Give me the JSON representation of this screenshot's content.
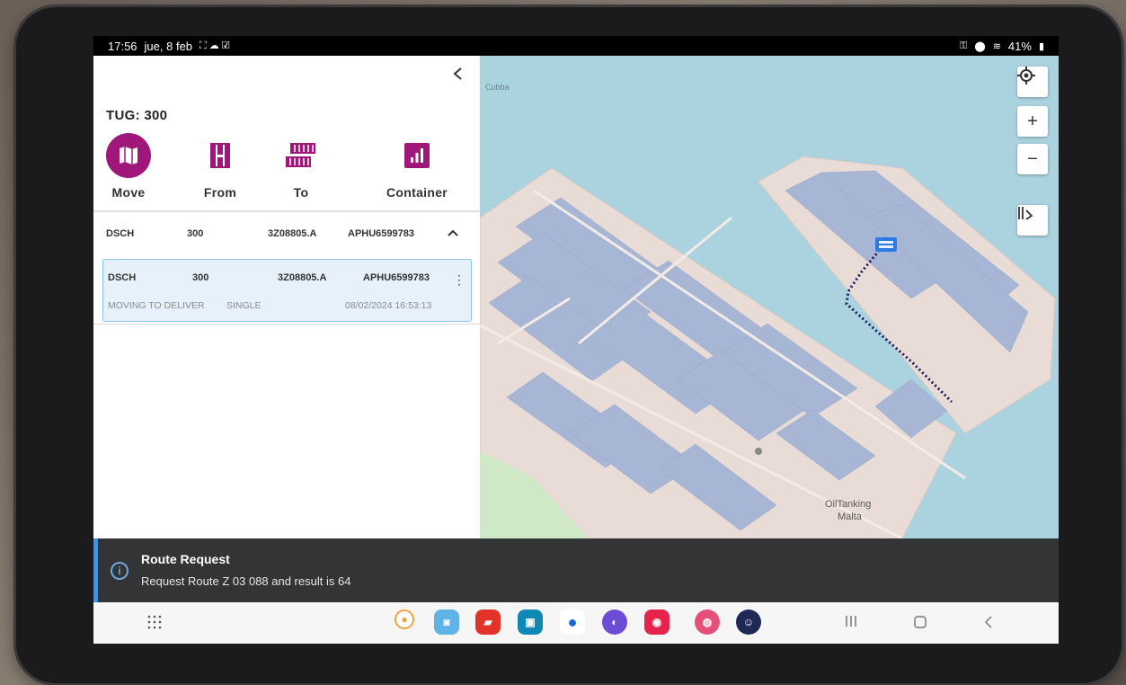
{
  "status_bar": {
    "time": "17:56",
    "date": "jue, 8 feb",
    "battery": "41%"
  },
  "panel": {
    "tug_title": "TUG: 300",
    "actions": [
      {
        "label": "Move",
        "icon": "map-icon"
      },
      {
        "label": "From",
        "icon": "container-slot-icon"
      },
      {
        "label": "To",
        "icon": "container-stack-icon"
      },
      {
        "label": "Container",
        "icon": "bar-chart-icon"
      }
    ],
    "job_header": {
      "type": "DSCH",
      "tug": "300",
      "position": "3Z08805.A",
      "container": "APHU6599783"
    },
    "job_card": {
      "type": "DSCH",
      "tug": "300",
      "position": "3Z08805.A",
      "container": "APHU6599783",
      "status": "MOVING TO DELIVER",
      "mode": "SINGLE",
      "timestamp": "08/02/2024 16:53:13"
    }
  },
  "map": {
    "labels": [
      "Cubba",
      "OilTanking",
      "Malta"
    ],
    "water_color": "#aad3df",
    "land_color": "#e9dcd6",
    "route_color": "#1a1a5e",
    "marker_color": "#2c7be5"
  },
  "snackbar": {
    "title": "Route Request",
    "message": "Request Route Z 03 088 and result is 64"
  }
}
